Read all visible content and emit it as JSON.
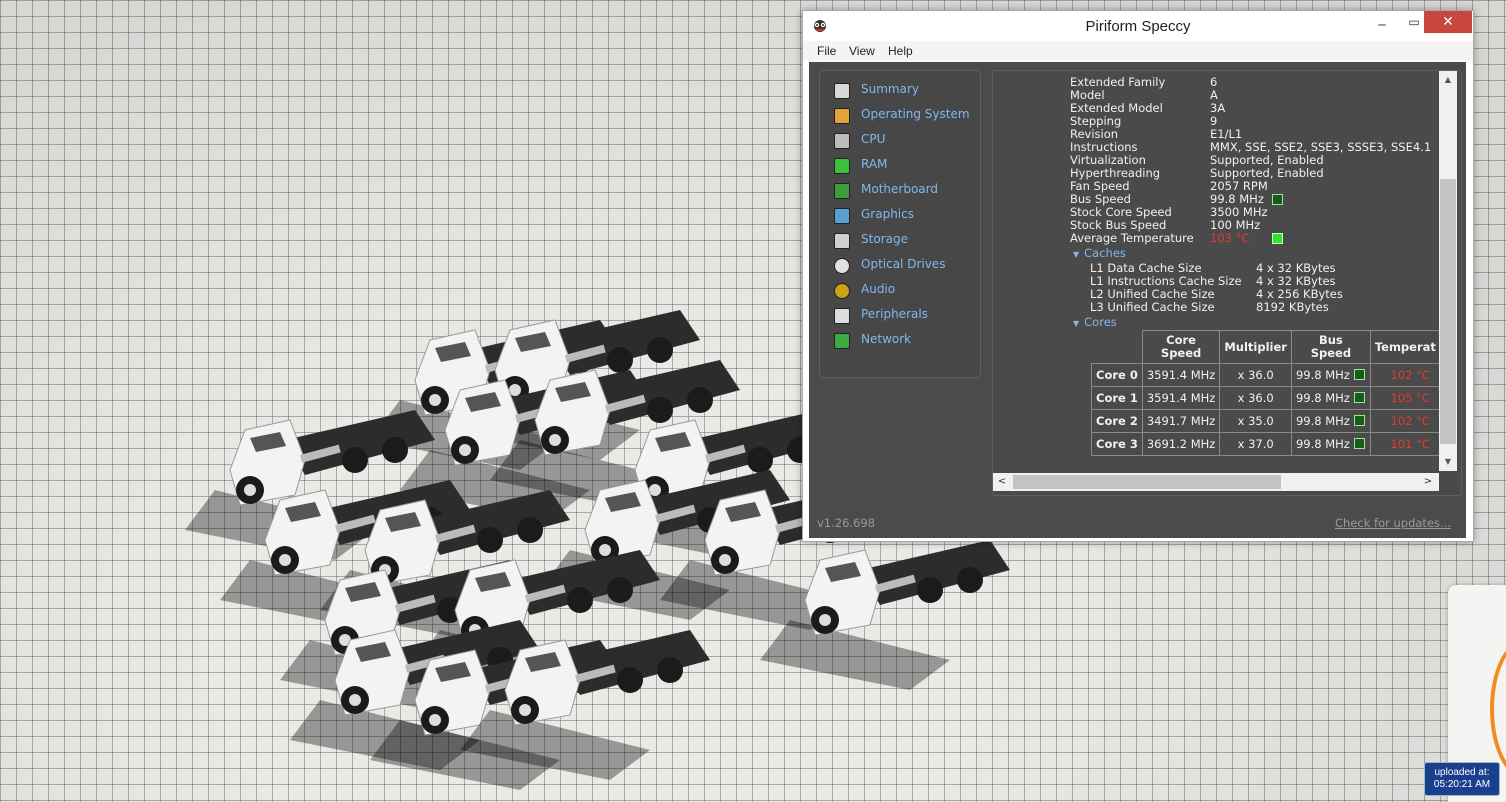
{
  "window": {
    "title": "Piriform Speccy"
  },
  "menu": [
    "File",
    "View",
    "Help"
  ],
  "nav": [
    {
      "label": "Summary",
      "icon": "summary-icon"
    },
    {
      "label": "Operating System",
      "icon": "windows-icon"
    },
    {
      "label": "CPU",
      "icon": "cpu-icon"
    },
    {
      "label": "RAM",
      "icon": "ram-icon"
    },
    {
      "label": "Motherboard",
      "icon": "motherboard-icon"
    },
    {
      "label": "Graphics",
      "icon": "monitor-icon"
    },
    {
      "label": "Storage",
      "icon": "disk-icon"
    },
    {
      "label": "Optical Drives",
      "icon": "optical-disc-icon"
    },
    {
      "label": "Audio",
      "icon": "speaker-icon"
    },
    {
      "label": "Peripherals",
      "icon": "mouse-icon"
    },
    {
      "label": "Network",
      "icon": "network-icon"
    }
  ],
  "cpu": {
    "props": [
      {
        "label": "Extended Family",
        "value": "6"
      },
      {
        "label": "Model",
        "value": "A"
      },
      {
        "label": "Extended Model",
        "value": "3A"
      },
      {
        "label": "Stepping",
        "value": "9"
      },
      {
        "label": "Revision",
        "value": "E1/L1"
      },
      {
        "label": "Instructions",
        "value": "MMX, SSE, SSE2, SSE3, SSSE3, SSE4.1"
      },
      {
        "label": "Virtualization",
        "value": "Supported, Enabled"
      },
      {
        "label": "Hyperthreading",
        "value": "Supported, Enabled"
      },
      {
        "label": "Fan Speed",
        "value": "2057 RPM"
      },
      {
        "label": "Bus Speed",
        "value": "99.8 MHz"
      },
      {
        "label": "Stock Core Speed",
        "value": "3500 MHz"
      },
      {
        "label": "Stock Bus Speed",
        "value": "100 MHz"
      },
      {
        "label": "Average Temperature",
        "value": "103 °C"
      }
    ],
    "caches_title": "Caches",
    "caches": [
      {
        "label": "L1 Data Cache Size",
        "value": "4 x 32 KBytes"
      },
      {
        "label": "L1 Instructions Cache Size",
        "value": "4 x 32 KBytes"
      },
      {
        "label": "L2 Unified Cache Size",
        "value": "4 x 256 KBytes"
      },
      {
        "label": "L3 Unified Cache Size",
        "value": "8192 KBytes"
      }
    ],
    "cores_title": "Cores",
    "core_headers": [
      "Core\nSpeed",
      "Multiplier",
      "Bus\nSpeed",
      "Temperat"
    ],
    "cores": [
      {
        "name": "Core 0",
        "speed": "3591.4 MHz",
        "mult": "x 36.0",
        "bus": "99.8 MHz",
        "temp": "102 °C"
      },
      {
        "name": "Core 1",
        "speed": "3591.4 MHz",
        "mult": "x 36.0",
        "bus": "99.8 MHz",
        "temp": "105 °C"
      },
      {
        "name": "Core 2",
        "speed": "3491.7 MHz",
        "mult": "x 35.0",
        "bus": "99.8 MHz",
        "temp": "102 °C"
      },
      {
        "name": "Core 3",
        "speed": "3691.2 MHz",
        "mult": "x 37.0",
        "bus": "99.8 MHz",
        "temp": "101 °C"
      }
    ]
  },
  "footer": {
    "version": "v1.26.698",
    "update_link": "Check for updates..."
  },
  "badge": {
    "line1": "uploaded at:",
    "line2": "05:20:21 AM"
  },
  "colors": {
    "accent": "#7fb9ef",
    "hot": "#e23b2e",
    "panel": "#4b4b4b"
  }
}
